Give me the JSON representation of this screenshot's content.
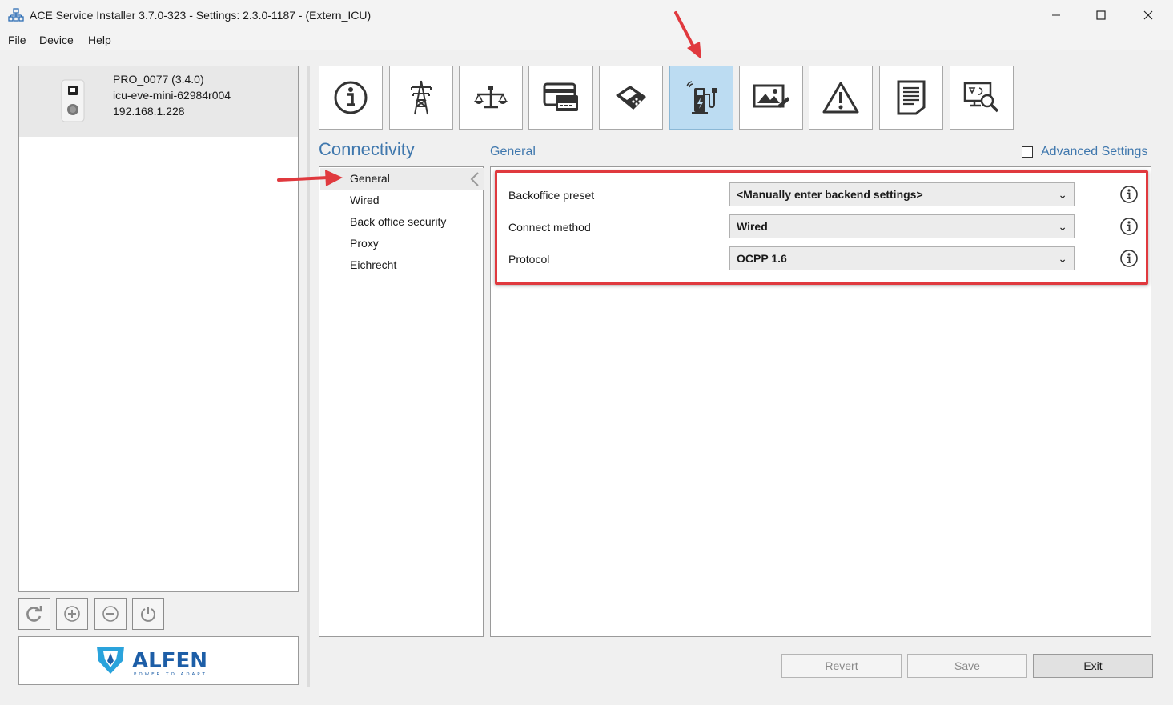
{
  "window": {
    "title": "ACE Service Installer 3.7.0-323 - Settings: 2.3.0-1187 -  (Extern_ICU)"
  },
  "menu": [
    "File",
    "Device",
    "Help"
  ],
  "device": {
    "name": "PRO_0077 (3.4.0)",
    "host": "icu-eve-mini-62984r004",
    "ip": "192.168.1.228"
  },
  "toolbar_icons": [
    "info-icon",
    "power-tower-icon",
    "balance-scale-icon",
    "card-reader-icon",
    "payment-terminal-icon",
    "charging-station-icon",
    "display-image-icon",
    "warning-icon",
    "document-icon",
    "diagnostics-icon"
  ],
  "active_tab": "charging-station-icon",
  "section": {
    "title": "Connectivity",
    "subtitle": "General",
    "advanced_label": "Advanced Settings",
    "advanced_checked": false
  },
  "subnav": [
    "General",
    "Wired",
    "Back office security",
    "Proxy",
    "Eichrecht"
  ],
  "settings": {
    "backoffice_label": "Backoffice preset",
    "backoffice_value": "<Manually enter backend settings>",
    "connect_label": "Connect method",
    "connect_value": "Wired",
    "protocol_label": "Protocol",
    "protocol_value": "OCPP 1.6"
  },
  "buttons": {
    "revert": "Revert",
    "save": "Save",
    "exit": "Exit"
  },
  "logo": {
    "brand": "ALFEN",
    "tagline": "POWER TO ADAPT"
  },
  "colors": {
    "accent": "#3f77ad",
    "active_tile": "#bcdcf2",
    "annotation": "#e0393e"
  }
}
